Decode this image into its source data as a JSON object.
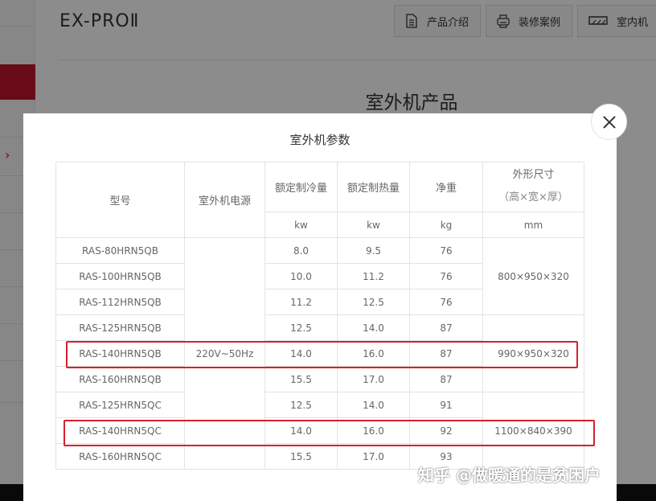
{
  "header": {
    "brand": "EX-PROⅡ",
    "tabs": [
      {
        "label": "产品介绍",
        "icon": "document-icon"
      },
      {
        "label": "装修案例",
        "icon": "print-icon"
      },
      {
        "label": "室内机",
        "icon": "ac-unit-icon"
      }
    ]
  },
  "page": {
    "heading": "室外机产品"
  },
  "modal": {
    "title": "室外机参数",
    "table": {
      "headers": {
        "model": "型号",
        "power": "室外机电源",
        "cooling": "额定制冷量",
        "heating": "额定制热量",
        "weight": "净重",
        "dimensions": "外形尺寸",
        "dimensions_sub": "（高×宽×厚）"
      },
      "units": {
        "cooling": "kw",
        "heating": "kw",
        "weight": "kg",
        "dimensions": "mm"
      },
      "power_value": "220V~50Hz",
      "rows": [
        {
          "model": "RAS-80HRN5QB",
          "cooling": "8.0",
          "heating": "9.5",
          "weight": "76"
        },
        {
          "model": "RAS-100HRN5QB",
          "cooling": "10.0",
          "heating": "11.2",
          "weight": "76"
        },
        {
          "model": "RAS-112HRN5QB",
          "cooling": "11.2",
          "heating": "12.5",
          "weight": "76"
        },
        {
          "model": "RAS-125HRN5QB",
          "cooling": "12.5",
          "heating": "14.0",
          "weight": "87"
        },
        {
          "model": "RAS-140HRN5QB",
          "cooling": "14.0",
          "heating": "16.0",
          "weight": "87"
        },
        {
          "model": "RAS-160HRN5QB",
          "cooling": "15.5",
          "heating": "17.0",
          "weight": "87"
        },
        {
          "model": "RAS-125HRN5QC",
          "cooling": "12.5",
          "heating": "14.0",
          "weight": "91"
        },
        {
          "model": "RAS-140HRN5QC",
          "cooling": "14.0",
          "heating": "16.0",
          "weight": "92"
        },
        {
          "model": "RAS-160HRN5QC",
          "cooling": "15.5",
          "heating": "17.0",
          "weight": "93"
        }
      ],
      "dimension_groups": [
        {
          "value": "800×950×320"
        },
        {
          "value": "990×950×320"
        },
        {
          "value": "1100×840×390"
        }
      ]
    }
  },
  "watermark": "知乎 @做暖通的是贫困户",
  "colors": {
    "accent": "#c0142c",
    "highlight": "#d5202e"
  }
}
